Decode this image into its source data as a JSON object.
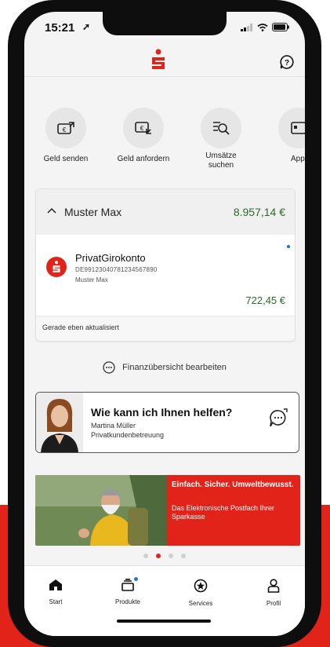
{
  "status": {
    "time": "15:21"
  },
  "colors": {
    "brand": "#e2231a",
    "positive": "#2a6b2a",
    "indicator": "#1a73e8"
  },
  "header": {
    "logo_icon": "sparkasse-logo",
    "help_icon": "help-icon"
  },
  "quick_actions": [
    {
      "label": "Geld senden",
      "icon": "send-money-icon"
    },
    {
      "label": "Geld anfordern",
      "icon": "request-money-icon"
    },
    {
      "label": "Umsätze suchen",
      "icon": "search-transactions-icon"
    },
    {
      "label": "Appl",
      "icon": "app-icon"
    }
  ],
  "accounts": {
    "owner_name": "Muster Max",
    "total": "8.957,14 €",
    "account": {
      "name": "PrivatGirokonto",
      "iban": "DE99123040781234567890",
      "owner": "Muster Max",
      "balance": "722,45 €"
    },
    "updated": "Gerade eben aktualisiert"
  },
  "edit_overview": "Finanzübersicht bearbeiten",
  "advisor": {
    "question": "Wie kann ich Ihnen helfen?",
    "name": "Martina Müller",
    "role": "Privatkundenbetreuung"
  },
  "banner": {
    "headline": "Einfach. Sicher. Umweltbewusst.",
    "text": "Das Elektronische Postfach Ihrer Sparkasse",
    "page_count": 4,
    "active_page": 2
  },
  "tabs": [
    {
      "label": "Start",
      "icon": "home-icon"
    },
    {
      "label": "Produkte",
      "icon": "products-icon"
    },
    {
      "label": "Services",
      "icon": "services-icon"
    },
    {
      "label": "Profil",
      "icon": "profile-icon"
    }
  ]
}
